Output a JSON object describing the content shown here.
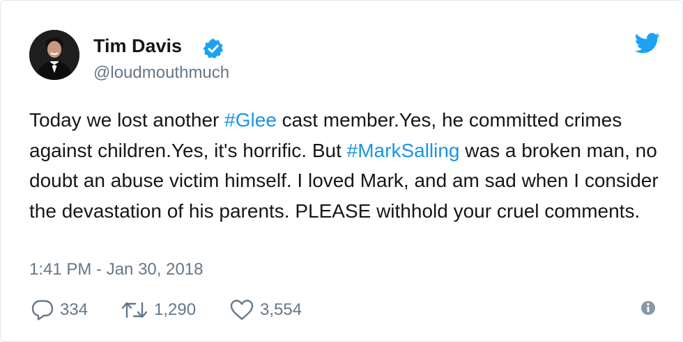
{
  "tweet": {
    "author": {
      "display_name": "Tim Davis",
      "handle": "@loudmouthmuch",
      "verified": true,
      "avatar_icon": "profile-photo"
    },
    "text_segments": [
      {
        "text": "Today we lost another ",
        "type": "text"
      },
      {
        "text": "#Glee",
        "type": "hashtag"
      },
      {
        "text": " cast member.Yes, he committed crimes against children.Yes, it's horrific. But ",
        "type": "text"
      },
      {
        "text": "#MarkSalling",
        "type": "hashtag"
      },
      {
        "text": " was a broken man, no doubt an abuse victim himself. I loved Mark, and am sad when I consider the devastation of his parents. PLEASE withhold your cruel comments.",
        "type": "text"
      }
    ],
    "timestamp": "1:41 PM - Jan 30, 2018",
    "actions": {
      "reply_count": "334",
      "retweet_count": "1,290",
      "like_count": "3,554"
    }
  },
  "colors": {
    "text": "#14171a",
    "secondary": "#657786",
    "accent": "#1b95e0",
    "twitter_blue": "#1da1f2",
    "border": "#e1e8ed"
  },
  "icons": [
    "twitter-bird-icon",
    "verified-badge-icon",
    "reply-icon",
    "retweet-icon",
    "like-icon",
    "info-icon"
  ]
}
